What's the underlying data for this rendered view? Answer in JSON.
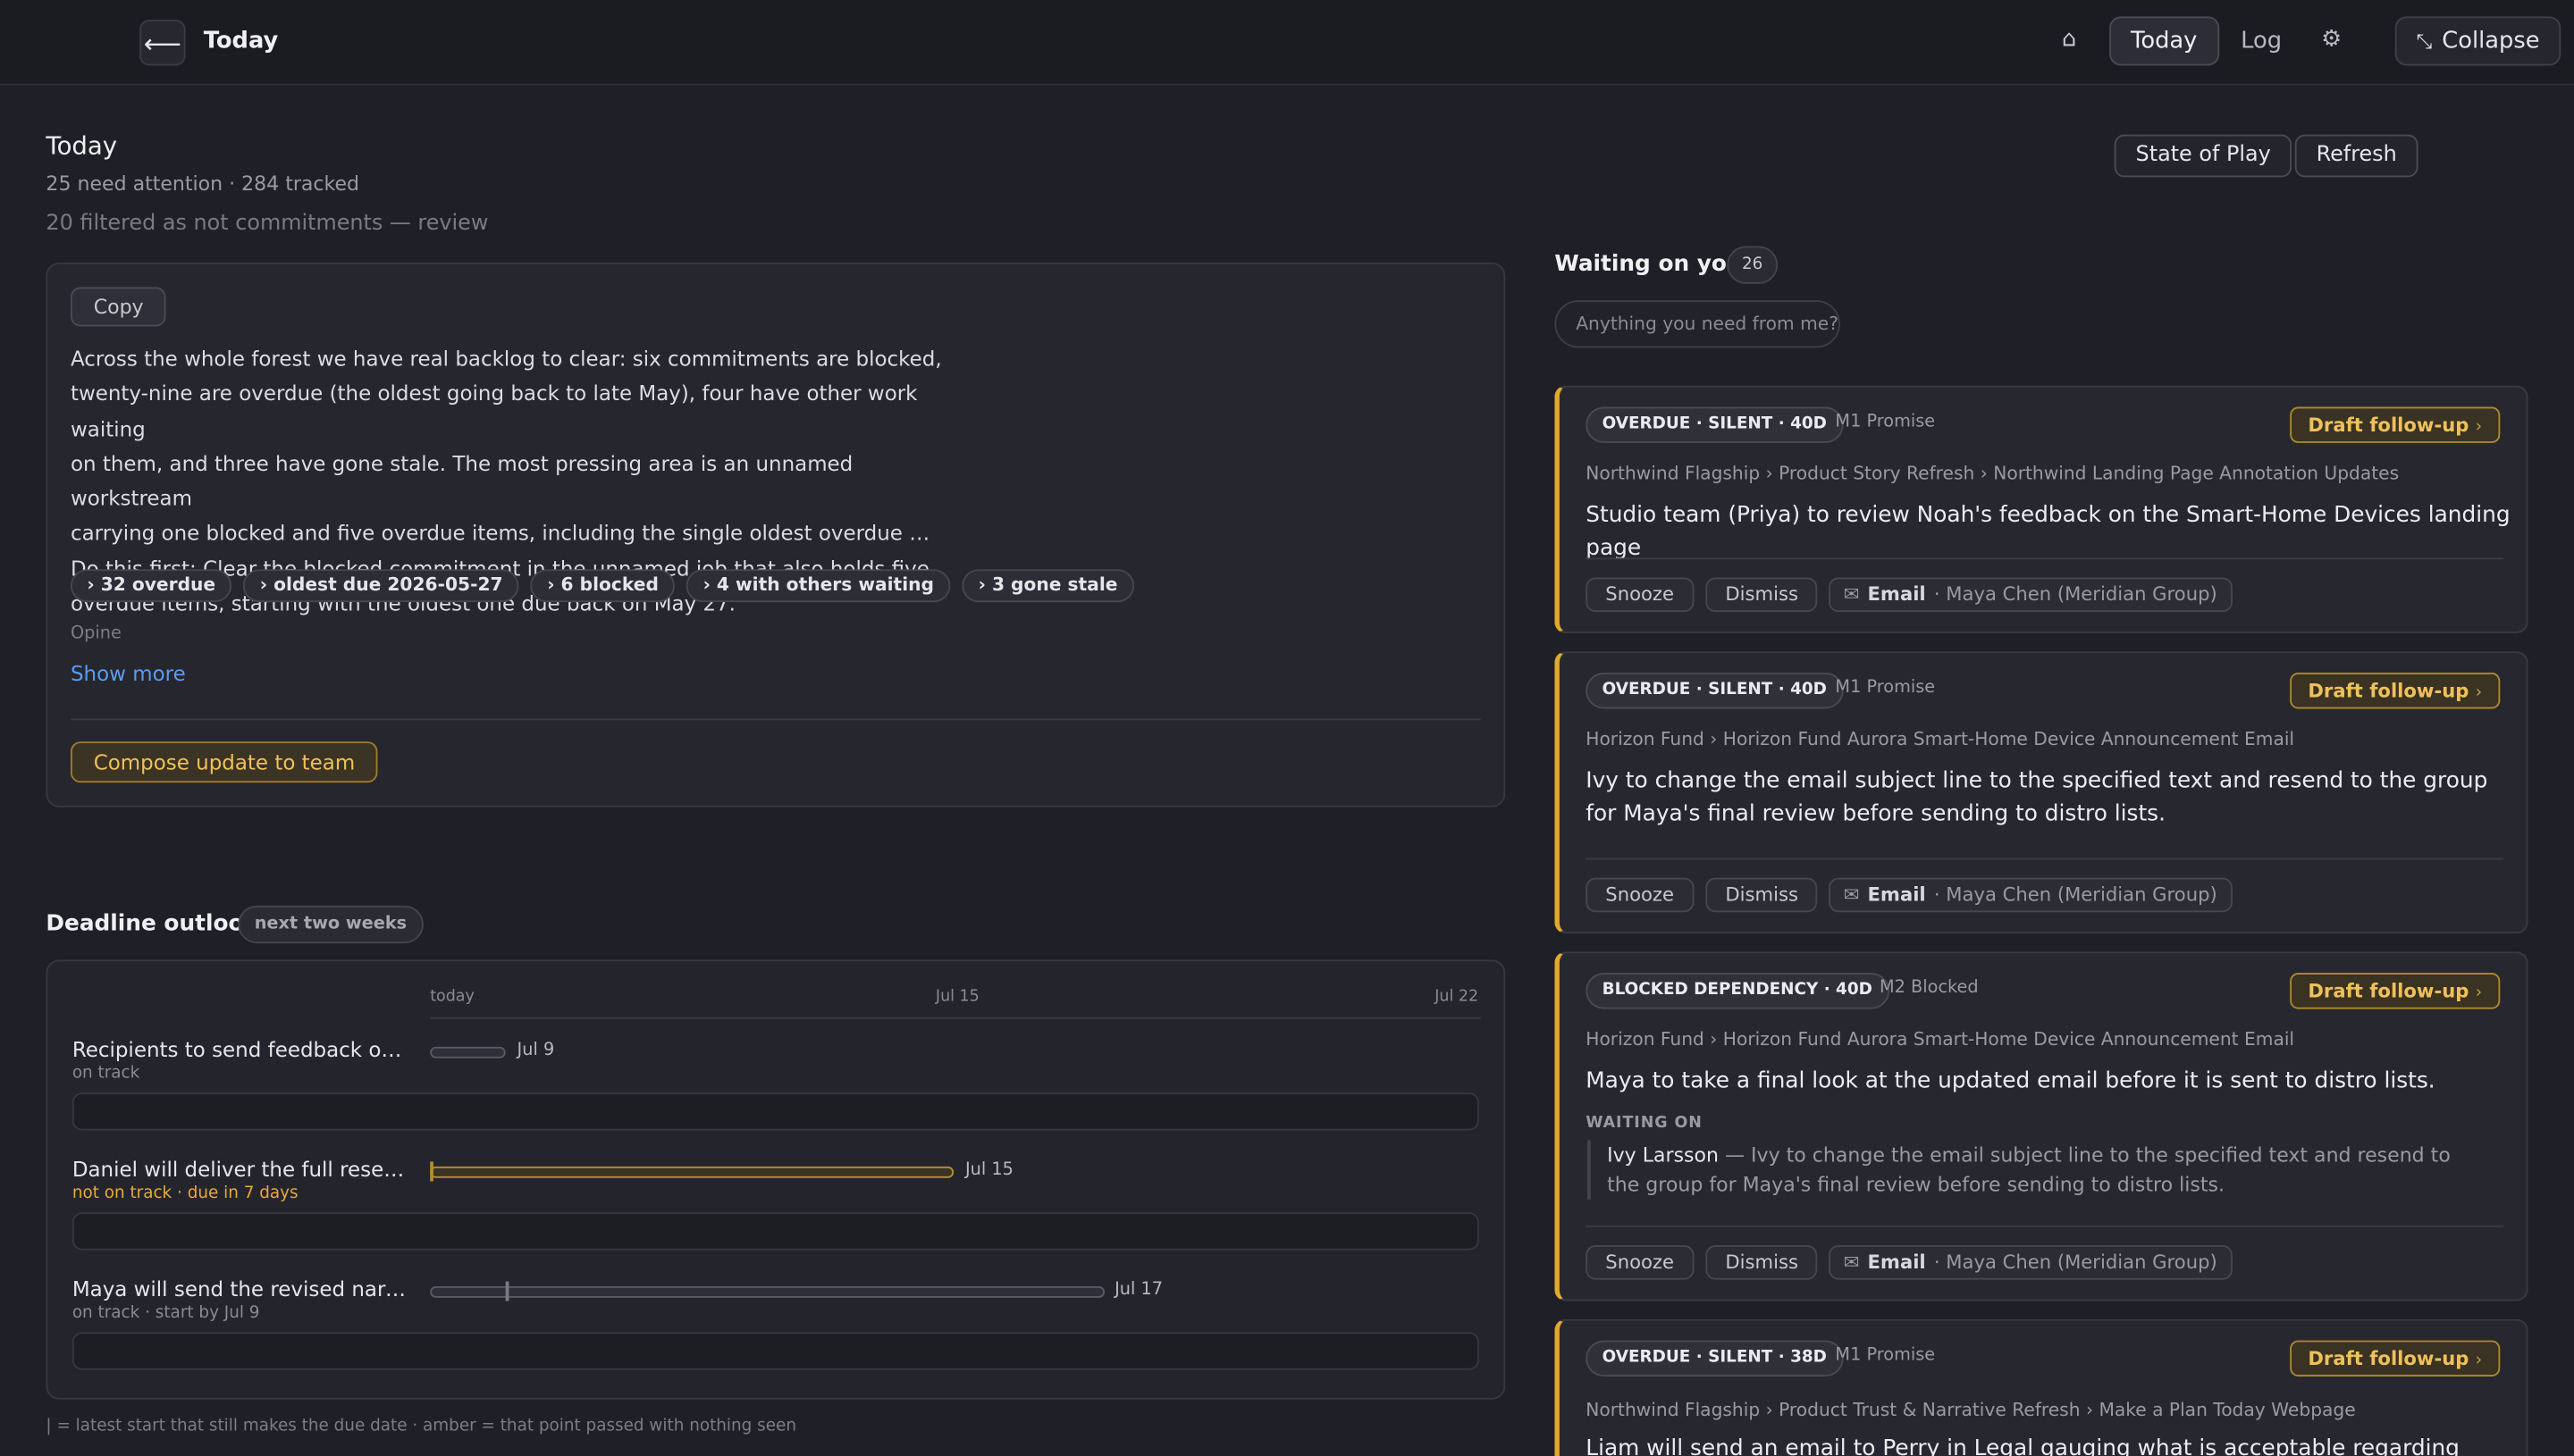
{
  "topbar": {
    "back_icon": "arrow-left-icon",
    "title": "Today",
    "home_icon": "home-icon",
    "nav_today": "Today",
    "nav_log": "Log",
    "settings_icon": "gear-icon",
    "collapse_label": "Collapse"
  },
  "header": {
    "title": "Today",
    "subtitle": "25 need attention · 284 tracked",
    "filtered": "20 filtered as not commitments — review",
    "state_of_play": "State of Play",
    "refresh": "Refresh"
  },
  "summary": {
    "copy": "Copy",
    "lines": [
      "Across the whole forest we have real backlog to clear: six commitments are blocked,",
      "twenty-nine are overdue (the oldest going back to late May), four have other work waiting",
      "on them, and three have gone stale. The most pressing area is an unnamed workstream",
      "carrying one blocked and five overdue items, including the single oldest overdue …",
      "Do this first: Clear the blocked commitment in the unnamed job that also holds five",
      "overdue items, starting with the oldest one due back on May 27."
    ],
    "chips": [
      "› 32 overdue",
      "› oldest due 2026-05-27",
      "› 6 blocked",
      "› 4 with others waiting",
      "› 3 gone stale"
    ],
    "opine": "Opine",
    "show_more": "Show more",
    "compose": "Compose update to team"
  },
  "deadline": {
    "title": "Deadline outlook",
    "badge": "next two weeks",
    "axis": [
      "today",
      "Jul 15",
      "Jul 22"
    ],
    "rows": [
      {
        "name": "Recipients to send feedback on t…",
        "status": "on track",
        "date": "Jul 9"
      },
      {
        "name": "Daniel will deliver the full researc…",
        "status": "not on track · due in 7 days",
        "date": "Jul 15"
      },
      {
        "name": "Maya will send the revised narrat…",
        "status": "on track · start by Jul 9",
        "date": "Jul 17"
      }
    ],
    "legend": "| = latest start that still makes the due date · amber = that point passed with nothing seen"
  },
  "waiting": {
    "title": "Waiting on you",
    "count": "26",
    "ask_placeholder": "Anything you need from me?",
    "cards": [
      {
        "badge": "OVERDUE · SILENT · 40D",
        "tag": "M1 Promise",
        "draft": "Draft follow-up",
        "crumb": "Northwind Flagship › Product Story Refresh › Northwind Landing Page Annotation Updates",
        "desc": "Studio team (Priya) to review Noah's feedback on the Smart-Home Devices landing page",
        "snooze": "Snooze",
        "dismiss": "Dismiss",
        "email": "Email",
        "email_from": "· Maya Chen (Meridian Group)"
      },
      {
        "badge": "OVERDUE · SILENT · 40D",
        "tag": "M1 Promise",
        "draft": "Draft follow-up",
        "crumb": "Horizon Fund › Horizon Fund Aurora Smart-Home Device Announcement Email",
        "desc": "Ivy to change the email subject line to the specified text and resend to the group for Maya's final review before sending to distro lists.",
        "snooze": "Snooze",
        "dismiss": "Dismiss",
        "email": "Email",
        "email_from": "· Maya Chen (Meridian Group)"
      },
      {
        "badge": "BLOCKED DEPENDENCY · 40D",
        "tag": "M2 Blocked",
        "draft": "Draft follow-up",
        "crumb": "Horizon Fund › Horizon Fund Aurora Smart-Home Device Announcement Email",
        "desc": "Maya to take a final look at the updated email before it is sent to distro lists.",
        "waiting_label": "WAITING ON",
        "waiting_who": "Ivy Larsson",
        "waiting_text": " — Ivy to change the email subject line to the specified text and resend to the group for Maya's final review before sending to distro lists.",
        "snooze": "Snooze",
        "dismiss": "Dismiss",
        "email": "Email",
        "email_from": "· Maya Chen (Meridian Group)"
      },
      {
        "badge": "OVERDUE · SILENT · 38D",
        "tag": "M1 Promise",
        "draft": "Draft follow-up",
        "crumb": "Northwind Flagship › Product Trust & Narrative Refresh › Make a Plan Today Webpage",
        "desc": "Liam will send an email to Perry in Legal gauging what is acceptable regarding featuring"
      }
    ]
  },
  "colors": {
    "background": "#1f2027",
    "accent_amber": "#e3a92c",
    "link_blue": "#5b9cf2"
  }
}
